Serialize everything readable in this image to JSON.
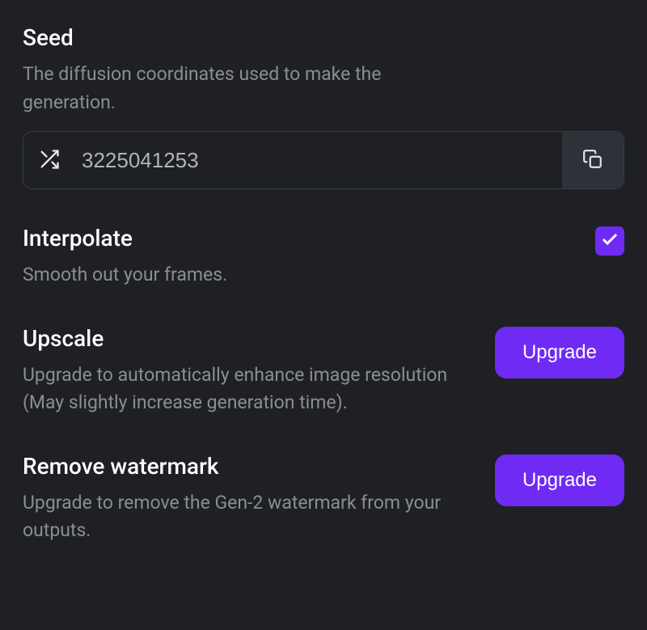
{
  "seed": {
    "title": "Seed",
    "description": "The diffusion coordinates used to make the generation.",
    "value": "3225041253"
  },
  "interpolate": {
    "title": "Interpolate",
    "description": "Smooth out your frames.",
    "checked": true
  },
  "upscale": {
    "title": "Upscale",
    "description": "Upgrade to automatically enhance image resolution (May slightly increase generation time).",
    "button_label": "Upgrade"
  },
  "remove_watermark": {
    "title": "Remove watermark",
    "description": "Upgrade to remove the Gen-2 watermark from your outputs.",
    "button_label": "Upgrade"
  }
}
